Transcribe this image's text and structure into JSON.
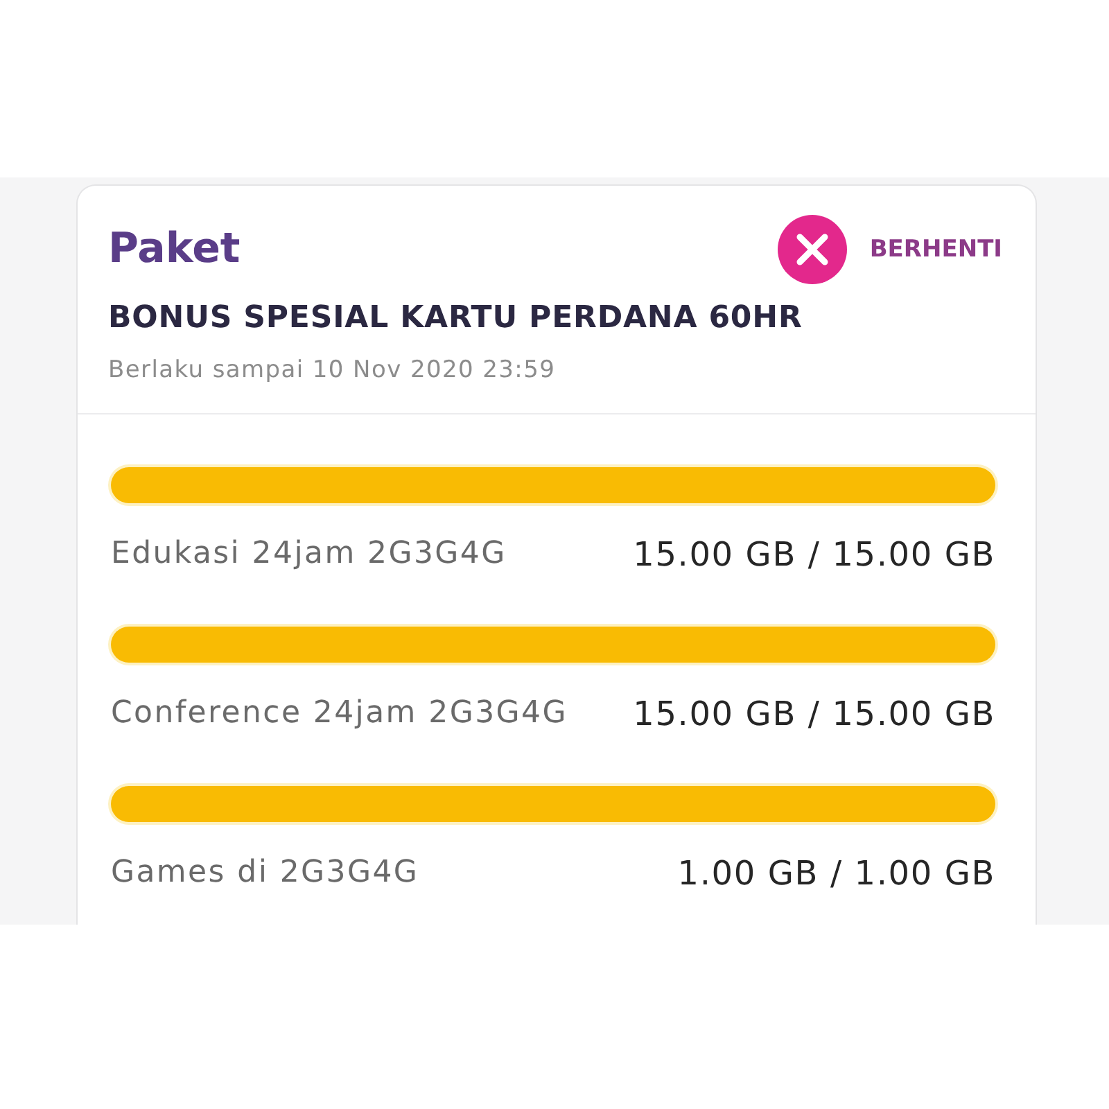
{
  "header": {
    "title": "Paket",
    "stop_button": {
      "label": "BERHENTI"
    },
    "package_name": "BONUS SPESIAL KARTU PERDANA 60HR",
    "valid_until": "Berlaku sampai 10 Nov 2020 23:59"
  },
  "quotas": [
    {
      "name": "Edukasi 24jam 2G3G4G",
      "level": 1,
      "reading": "15.00 GB / 15.00 GB"
    },
    {
      "name": "Conference 24jam 2G3G4G",
      "level": 1,
      "reading": "15.00 GB / 15.00 GB"
    },
    {
      "name": "Games di 2G3G4G",
      "level": 1,
      "reading": "1.00 GB / 1.00 GB"
    }
  ]
}
